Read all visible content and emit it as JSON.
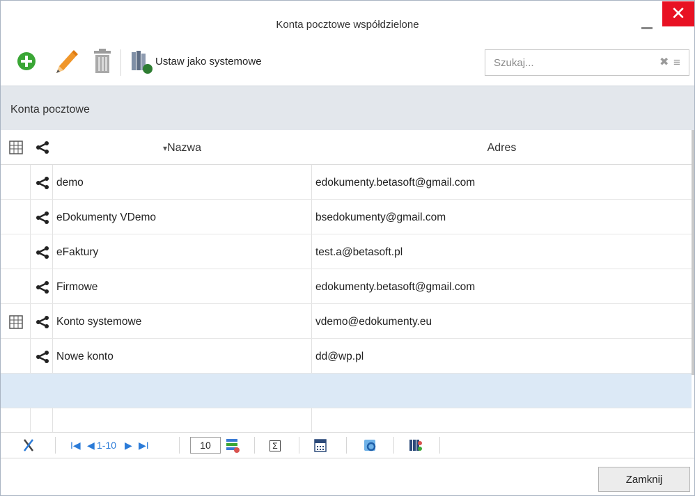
{
  "window": {
    "title": "Konta pocztowe współdzielone",
    "close_glyph": "✕"
  },
  "toolbar": {
    "add_icon": "add-icon",
    "edit_icon": "pencil-icon",
    "delete_icon": "trash-icon",
    "system_icon": "books-icon",
    "system_label": "Ustaw jako systemowe"
  },
  "search": {
    "placeholder": "Szukaj...",
    "clear_glyph": "✖",
    "menu_glyph": "≡"
  },
  "panel": {
    "title": "Konta pocztowe"
  },
  "grid": {
    "columns": {
      "name": "Nazwa",
      "address": "Adres",
      "sort_glyph": "▾"
    },
    "rows": [
      {
        "system": false,
        "shared": true,
        "name": "demo",
        "address": "edokumenty.betasoft@gmail.com"
      },
      {
        "system": false,
        "shared": true,
        "name": "eDokumenty VDemo",
        "address": "bsedokumenty@gmail.com"
      },
      {
        "system": false,
        "shared": true,
        "name": "eFaktury",
        "address": "test.a@betasoft.pl"
      },
      {
        "system": false,
        "shared": true,
        "name": "Firmowe",
        "address": "edokumenty.betasoft@gmail.com"
      },
      {
        "system": true,
        "shared": true,
        "name": "Konto systemowe",
        "address": "vdemo@edokumenty.eu"
      },
      {
        "system": false,
        "shared": true,
        "name": "Nowe konto",
        "address": "dd@wp.pl"
      }
    ]
  },
  "pager": {
    "first_glyph": "I◀",
    "prev_glyph": "◀",
    "range": "1-10",
    "next_glyph": "▶",
    "last_glyph": "▶I",
    "page_size": "10",
    "sum_glyph": "Σ"
  },
  "footer": {
    "close_label": "Zamknij"
  },
  "colors": {
    "accent": "#2b7bd8",
    "close": "#e81123",
    "add": "#3aa635",
    "edit": "#f0962a",
    "selected_row": "#dce9f6"
  }
}
